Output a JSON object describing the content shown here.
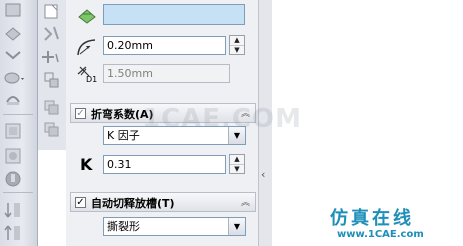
{
  "edge_flange": {
    "radius_value": "0.20mm",
    "gap_value": "1.50mm"
  },
  "bend_allowance": {
    "label": "折弯系数(A)",
    "selected_type": "K 因子",
    "k_symbol": "K",
    "k_value": "0.31"
  },
  "auto_relief": {
    "label": "自动切释放槽(T)",
    "selected_type": "撕裂形"
  },
  "watermark": {
    "center_text": "1CAE.COM",
    "chinese": "仿真在线",
    "url": "www.1CAE.com"
  },
  "d1_label": "D1",
  "colors": {
    "accent_field": "#c6e0f5",
    "watermark": "#1d8fb8"
  }
}
